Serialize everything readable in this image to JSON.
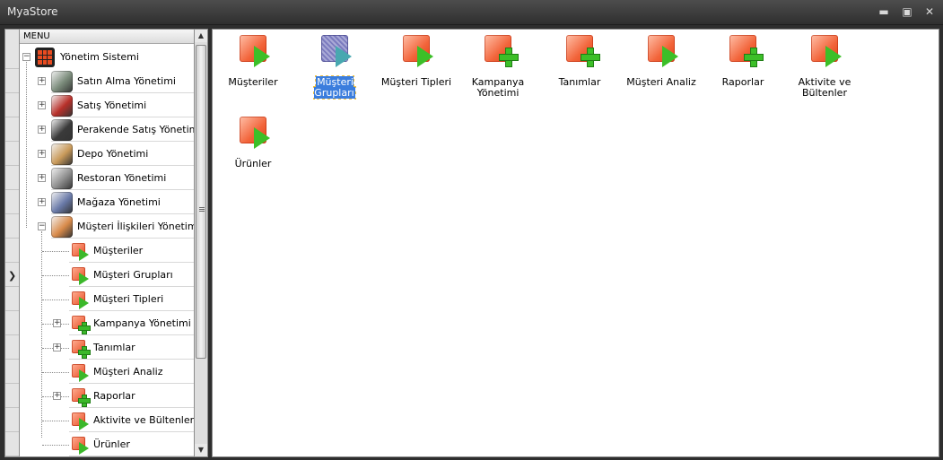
{
  "window": {
    "title": "MyaStore",
    "controls": [
      "minimize",
      "maximize",
      "close"
    ]
  },
  "menu": {
    "header": "MENU",
    "root": "Yönetim Sistemi",
    "categories": [
      {
        "label": "Satın Alma Yönetimi",
        "color": "#7a8b7a"
      },
      {
        "label": "Satış Yönetimi",
        "color": "#b8302a"
      },
      {
        "label": "Perakende Satış Yönetimi",
        "color": "#3a3a3a"
      },
      {
        "label": "Depo Yönetimi",
        "color": "#c99a5a"
      },
      {
        "label": "Restoran Yönetimi",
        "color": "#8e8e8e"
      },
      {
        "label": "Mağaza Yönetimi",
        "color": "#6a7aa8"
      },
      {
        "label": "Müşteri İlişkileri Yönetimi",
        "color": "#d88a4a"
      }
    ],
    "crm_children": [
      {
        "label": "Müşteriler",
        "icon": "play",
        "expandable": false
      },
      {
        "label": "Müşteri Grupları",
        "icon": "play",
        "expandable": false
      },
      {
        "label": "Müşteri Tipleri",
        "icon": "play",
        "expandable": false
      },
      {
        "label": "Kampanya Yönetimi",
        "icon": "plus",
        "expandable": true
      },
      {
        "label": "Tanımlar",
        "icon": "plus",
        "expandable": true
      },
      {
        "label": "Müşteri Analiz",
        "icon": "play",
        "expandable": false
      },
      {
        "label": "Raporlar",
        "icon": "plus",
        "expandable": true
      },
      {
        "label": "Aktivite ve Bültenler",
        "icon": "play",
        "expandable": false
      },
      {
        "label": "Ürünler",
        "icon": "play",
        "expandable": false
      }
    ]
  },
  "content": {
    "items": [
      {
        "label": "Müşteriler",
        "icon": "play",
        "selected": false
      },
      {
        "label": "Müşteri Grupları",
        "icon": "play",
        "selected": true
      },
      {
        "label": "Müşteri Tipleri",
        "icon": "play",
        "selected": false
      },
      {
        "label": "Kampanya Yönetimi",
        "icon": "plus",
        "selected": false
      },
      {
        "label": "Tanımlar",
        "icon": "plus",
        "selected": false
      },
      {
        "label": "Müşteri Analiz",
        "icon": "play",
        "selected": false
      },
      {
        "label": "Raporlar",
        "icon": "plus",
        "selected": false
      },
      {
        "label": "Aktivite ve Bültenler",
        "icon": "play",
        "selected": false
      },
      {
        "label": "Ürünler",
        "icon": "play",
        "selected": false
      }
    ]
  }
}
